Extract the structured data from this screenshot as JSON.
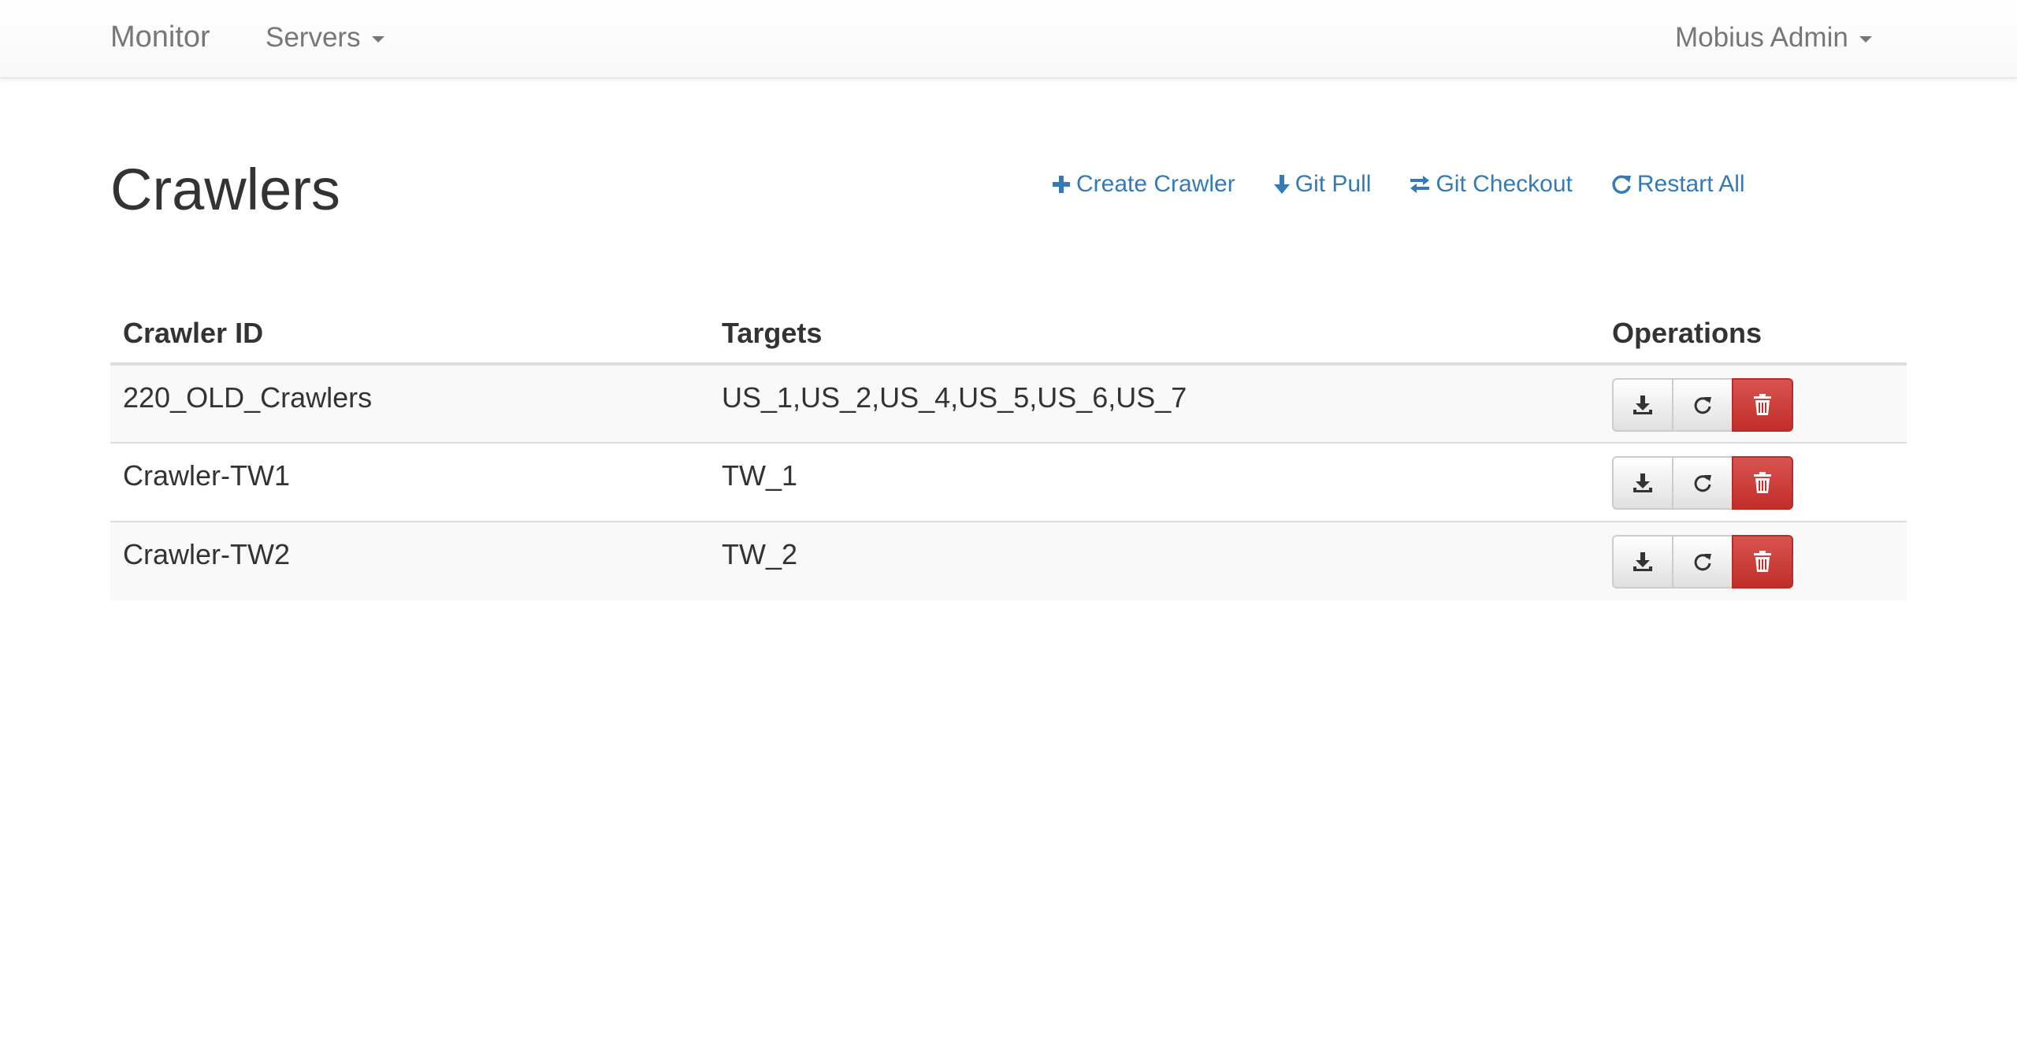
{
  "navbar": {
    "brand": "Monitor",
    "servers_label": "Servers",
    "user_label": "Mobius Admin"
  },
  "page": {
    "title": "Crawlers"
  },
  "actions": {
    "create": "Create Crawler",
    "pull": "Git Pull",
    "checkout": "Git Checkout",
    "restart": "Restart All"
  },
  "table": {
    "headers": [
      "Crawler ID",
      "Targets",
      "Operations"
    ],
    "rows": [
      {
        "id": "220_OLD_Crawlers",
        "targets": "US_1,US_2,US_4,US_5,US_6,US_7"
      },
      {
        "id": "Crawler-TW1",
        "targets": "TW_1"
      },
      {
        "id": "Crawler-TW2",
        "targets": "TW_2"
      }
    ]
  },
  "icons": {
    "download": "download-icon",
    "refresh": "refresh-icon",
    "trash": "trash-icon"
  },
  "colors": {
    "link": "#337ab7",
    "danger": "#d9534f",
    "nav_text": "#777777"
  }
}
